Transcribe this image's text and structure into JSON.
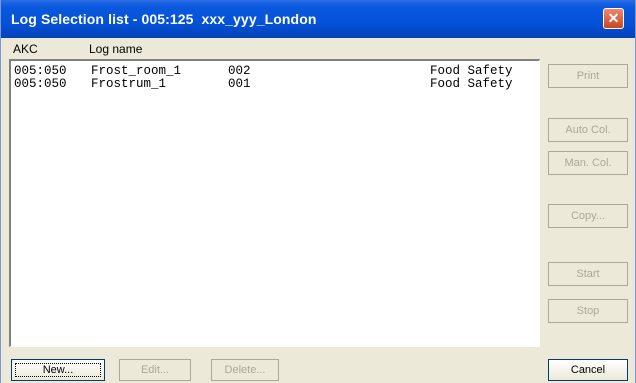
{
  "window": {
    "title": "Log Selection list - 005:125  xxx_yyy_London",
    "close_glyph": "✕"
  },
  "columns": {
    "akc": "AKC",
    "log_name": "Log name"
  },
  "rows": [
    {
      "akc": "005:050",
      "name": "Frost_room_1",
      "num": "002",
      "category": "Food Safety"
    },
    {
      "akc": "005:050",
      "name": "Frostrum_1",
      "num": "001",
      "category": "Food Safety"
    }
  ],
  "side_buttons": {
    "print": "Print",
    "auto_col": "Auto Col.",
    "man_col": "Man. Col.",
    "copy": "Copy...",
    "start": "Start",
    "stop": "Stop"
  },
  "bottom_buttons": {
    "new": "New...",
    "edit": "Edit...",
    "delete": "Delete...",
    "cancel": "Cancel"
  }
}
